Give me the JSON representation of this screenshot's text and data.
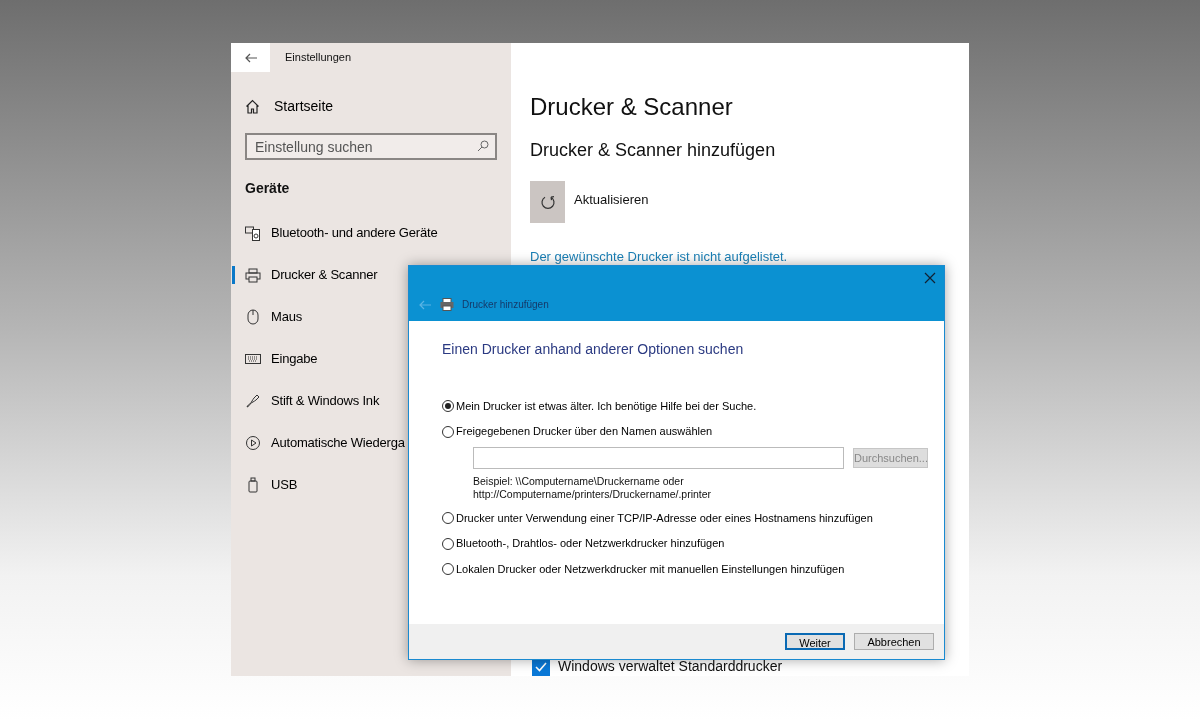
{
  "settings": {
    "title": "Einstellungen",
    "sidebar": {
      "home": "Startseite",
      "search": {
        "placeholder": "Einstellung suchen"
      },
      "section": "Geräte",
      "items": [
        {
          "label": "Bluetooth- und andere Geräte",
          "selected": false
        },
        {
          "label": "Drucker & Scanner",
          "selected": true
        },
        {
          "label": "Maus",
          "selected": false
        },
        {
          "label": "Eingabe",
          "selected": false
        },
        {
          "label": "Stift & Windows Ink",
          "selected": false
        },
        {
          "label": "Automatische Wiederga",
          "selected": false
        },
        {
          "label": "USB",
          "selected": false
        }
      ]
    },
    "main": {
      "title": "Drucker & Scanner",
      "subtitle": "Drucker & Scanner hinzufügen",
      "refresh": "Aktualisieren",
      "link": "Der gewünschte Drucker ist nicht aufgelistet.",
      "default_printer": {
        "label": "Windows verwaltet Standarddrucker",
        "checked": true
      }
    }
  },
  "dialog": {
    "title": "Drucker hinzufügen",
    "heading": "Einen Drucker anhand anderer Optionen suchen",
    "options": [
      {
        "label": "Mein Drucker ist etwas älter. Ich benötige Hilfe bei der Suche.",
        "selected": true
      },
      {
        "label": "Freigegebenen Drucker über den Namen auswählen",
        "selected": false,
        "field": {
          "browse": "Durchsuchen...",
          "browse_disabled": true,
          "example": [
            "Beispiel: \\\\Computername\\Druckername oder",
            "http://Computername/printers/Druckername/.printer"
          ]
        }
      },
      {
        "label": "Drucker unter Verwendung einer TCP/IP-Adresse oder eines Hostnamens hinzufügen",
        "selected": false
      },
      {
        "label": "Bluetooth-, Drahtlos- oder Netzwerkdrucker hinzufügen",
        "selected": false
      },
      {
        "label": "Lokalen Drucker oder Netzwerkdrucker mit manuellen Einstellungen hinzufügen",
        "selected": false
      }
    ],
    "buttons": [
      {
        "label": "Weiter",
        "default": true
      },
      {
        "label": "Abbrechen",
        "default": false
      }
    ]
  }
}
